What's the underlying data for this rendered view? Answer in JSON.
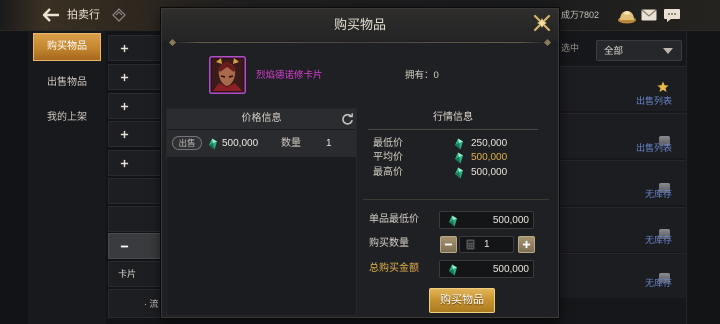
{
  "topbar": {
    "title": "拍卖行",
    "currency_text": "成万7802"
  },
  "sidebar": {
    "items": [
      {
        "label": "购买物品",
        "selected": true
      },
      {
        "label": "出售物品",
        "selected": false
      },
      {
        "label": "我的上架",
        "selected": false
      }
    ]
  },
  "background_list": {
    "card_label": "卡片",
    "misc_label": "· 流"
  },
  "background_filter": {
    "filter_label": "选中",
    "dropdown_value": "全部"
  },
  "background_rows": [
    {
      "status": "出售列表",
      "starred": true
    },
    {
      "status": "出售列表",
      "starred": false
    },
    {
      "status": "无库存",
      "starred": false
    },
    {
      "status": "无库存",
      "starred": false
    },
    {
      "status": "无库存",
      "starred": false
    }
  ],
  "modal": {
    "title": "购买物品",
    "item": {
      "name": "烈焰德诺修卡片",
      "owned": "拥有：0"
    },
    "price_info": {
      "header": "价格信息",
      "listings": [
        {
          "tag": "出售",
          "price": "500,000",
          "qty_label": "数量",
          "qty": "1"
        }
      ]
    },
    "market_info": {
      "header": "行情信息",
      "rows": [
        {
          "label": "最低价",
          "value": "250,000"
        },
        {
          "label": "平均价",
          "value": "500,000"
        },
        {
          "label": "最高价",
          "value": "500,000"
        }
      ]
    },
    "purchase_form": {
      "unit_min_label": "单品最低价",
      "unit_min_value": "500,000",
      "quantity_label": "购买数量",
      "quantity_value": "1",
      "total_label": "总购买金额",
      "total_value": "500,000"
    },
    "buy_button": "购买物品"
  },
  "icons": {
    "back": "back-arrow-icon",
    "auction_badge": "diamond-icon",
    "gold": "gold-pile-icon",
    "mail": "mail-icon",
    "chat": "chat-icon",
    "close": "close-icon",
    "refresh": "refresh-icon",
    "currency": "gem-icon",
    "calculator": "calculator-icon",
    "favorite": "star-icon",
    "expand": "plus-icon",
    "collapse": "minus-icon",
    "dropdown": "chevron-down-icon",
    "item_thumb": "item-thumb-icon"
  },
  "colors": {
    "accent_gold": "#e2b04a",
    "item_magenta": "#d83fd6",
    "status_blue": "#6784cc",
    "tab_active": "#c3862f",
    "currency_green": "#3fc08e"
  }
}
